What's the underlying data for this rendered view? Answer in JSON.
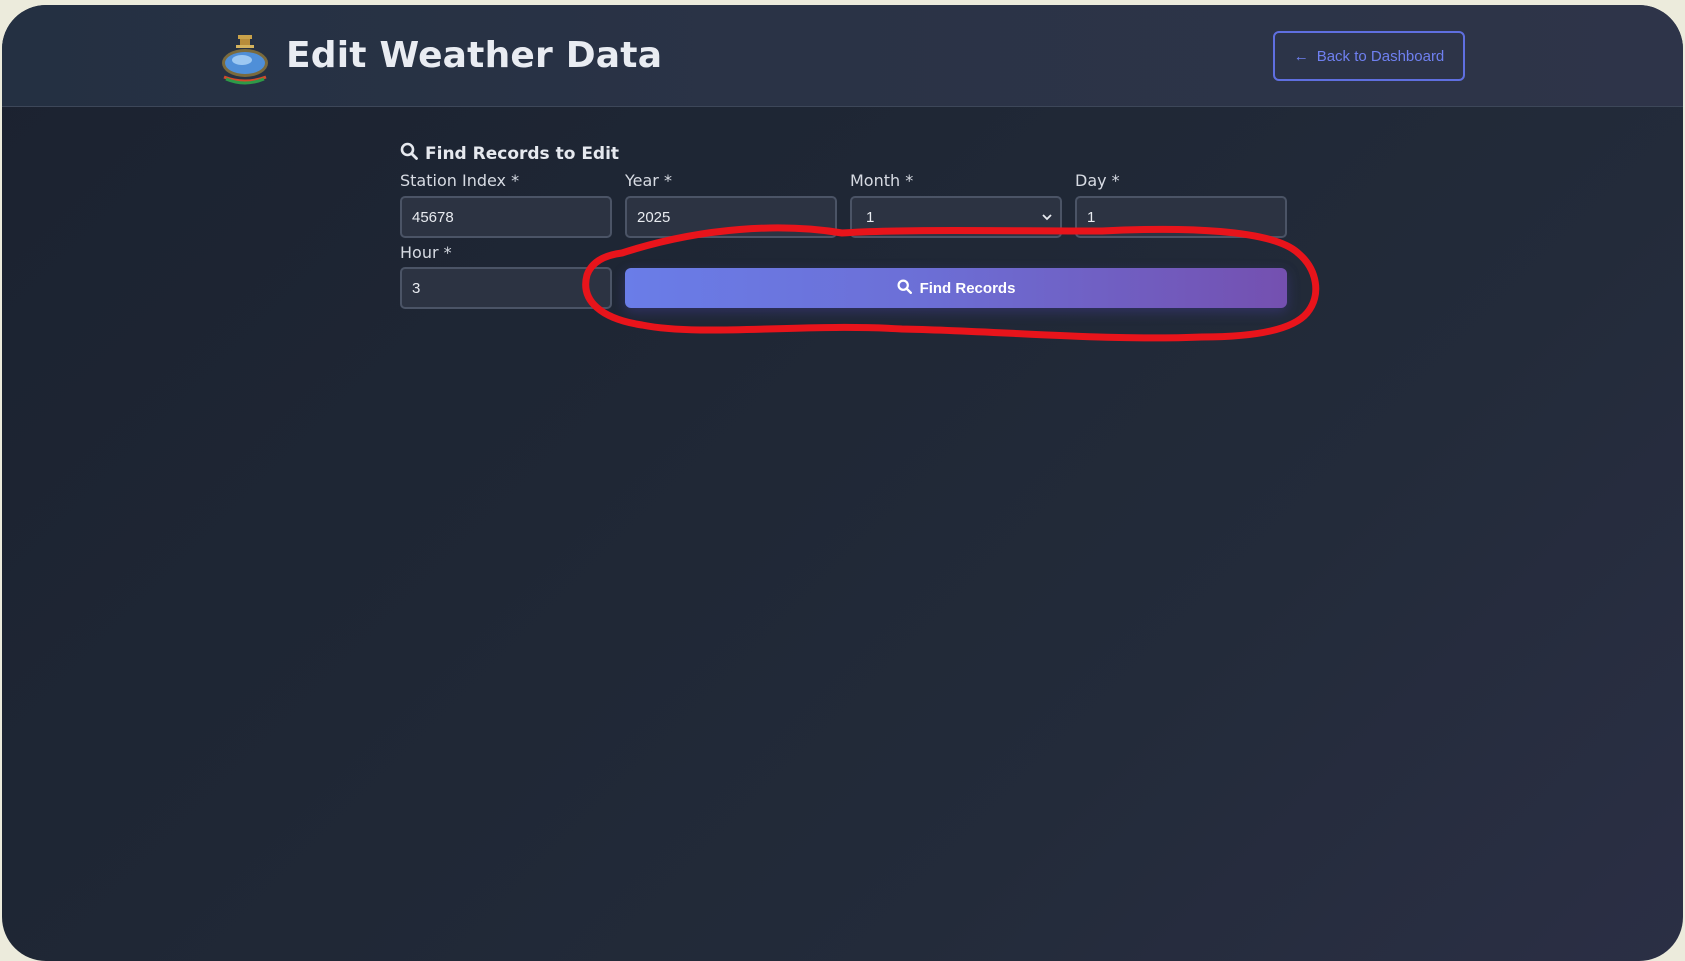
{
  "header": {
    "title": "Edit Weather Data",
    "back_label": "Back to Dashboard",
    "emblem_icon": "government-emblem-icon"
  },
  "search": {
    "section_title": "Find Records to Edit",
    "fields": {
      "station_index": {
        "label": "Station Index *",
        "value": "45678"
      },
      "year": {
        "label": "Year *",
        "value": "2025"
      },
      "month": {
        "label": "Month *",
        "value": "1"
      },
      "day": {
        "label": "Day *",
        "value": "1"
      },
      "hour": {
        "label": "Hour *",
        "value": "3"
      }
    },
    "find_button_label": "Find Records"
  },
  "annotation": {
    "color": "#e8141b",
    "shape": "hand-drawn-circle"
  },
  "colors": {
    "accent": "#6a7de8",
    "accent_end": "#7450b0",
    "background": "#1f2735",
    "outer": "#ecebdc"
  }
}
